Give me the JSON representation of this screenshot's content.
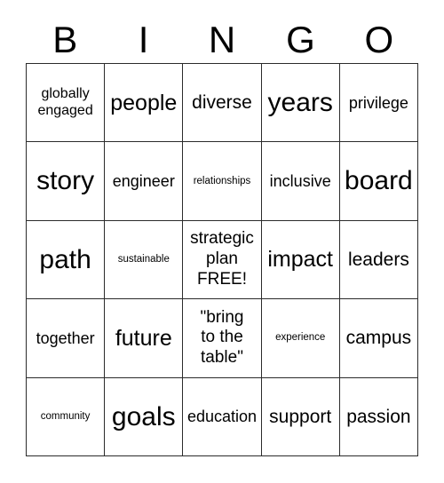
{
  "card": {
    "title_letters": [
      "B",
      "I",
      "N",
      "G",
      "O"
    ],
    "rows": [
      [
        {
          "text": "globally\nengaged",
          "size": "fs-multi2"
        },
        {
          "text": "people",
          "size": "fs-xl"
        },
        {
          "text": "diverse",
          "size": "fs-lg"
        },
        {
          "text": "years",
          "size": "fs-xxl"
        },
        {
          "text": "privilege",
          "size": "fs-md"
        }
      ],
      [
        {
          "text": "story",
          "size": "fs-xxl"
        },
        {
          "text": "engineer",
          "size": "fs-md"
        },
        {
          "text": "relationships",
          "size": "fs-xs"
        },
        {
          "text": "inclusive",
          "size": "fs-md"
        },
        {
          "text": "board",
          "size": "fs-xxl"
        }
      ],
      [
        {
          "text": "path",
          "size": "fs-xxl"
        },
        {
          "text": "sustainable",
          "size": "fs-xs"
        },
        {
          "text": "strategic\nplan\nFREE!",
          "size": "fs-multi3"
        },
        {
          "text": "impact",
          "size": "fs-xl"
        },
        {
          "text": "leaders",
          "size": "fs-lg"
        }
      ],
      [
        {
          "text": "together",
          "size": "fs-md"
        },
        {
          "text": "future",
          "size": "fs-xl"
        },
        {
          "text": "\"bring\nto the\ntable\"",
          "size": "fs-multi3"
        },
        {
          "text": "experience",
          "size": "fs-xs"
        },
        {
          "text": "campus",
          "size": "fs-lg"
        }
      ],
      [
        {
          "text": "community",
          "size": "fs-xs"
        },
        {
          "text": "goals",
          "size": "fs-xxl"
        },
        {
          "text": "education",
          "size": "fs-md"
        },
        {
          "text": "support",
          "size": "fs-lg"
        },
        {
          "text": "passion",
          "size": "fs-lg"
        }
      ]
    ],
    "colors": {
      "background": "#ffffff",
      "text": "#000000",
      "grid_line": "#2b2b2b"
    }
  }
}
